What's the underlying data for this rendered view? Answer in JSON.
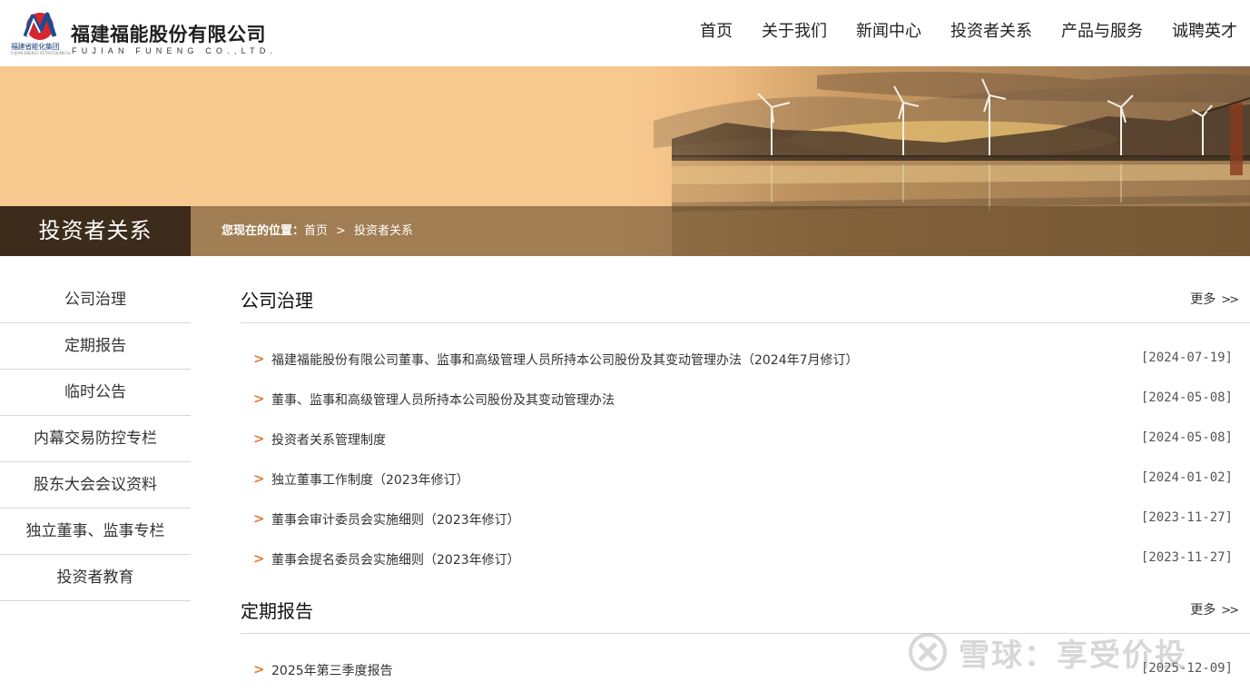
{
  "header": {
    "logo_group_text": "福建省能化集团",
    "logo_group_en": "FUJIAN ENERGY PETROCHEMICAL",
    "company_name_cn": "福建福能股份有限公司",
    "company_name_en": "FUJIAN FUNENG CO.,LTD.",
    "nav": [
      "首页",
      "关于我们",
      "新闻中心",
      "投资者关系",
      "产品与服务",
      "诚聘英才"
    ]
  },
  "banner": {
    "section_label": "投资者关系",
    "breadcrumb_label": "您现在的位置：",
    "breadcrumb": [
      "首页",
      "投资者关系"
    ],
    "breadcrumb_separator": ">"
  },
  "sidebar": {
    "items": [
      "公司治理",
      "定期报告",
      "临时公告",
      "内幕交易防控专栏",
      "股东大会会议资料",
      "独立董事、监事专栏",
      "投资者教育"
    ]
  },
  "sections": [
    {
      "title": "公司治理",
      "more": "更多",
      "items": [
        {
          "title": "福建福能股份有限公司董事、监事和高级管理人员所持本公司股份及其变动管理办法（2024年7月修订）",
          "date": "[2024-07-19]"
        },
        {
          "title": "董事、监事和高级管理人员所持本公司股份及其变动管理办法",
          "date": "[2024-05-08]"
        },
        {
          "title": "投资者关系管理制度",
          "date": "[2024-05-08]"
        },
        {
          "title": "独立董事工作制度（2023年修订）",
          "date": "[2024-01-02]"
        },
        {
          "title": "董事会审计委员会实施细则（2023年修订）",
          "date": "[2023-11-27]"
        },
        {
          "title": "董事会提名委员会实施细则（2023年修订）",
          "date": "[2023-11-27]"
        }
      ]
    },
    {
      "title": "定期报告",
      "more": "更多",
      "items": [
        {
          "title": "2025年第三季度报告",
          "date": "[2025-12-09]"
        }
      ]
    }
  ],
  "watermark": {
    "text": "雪球：享受价投"
  },
  "colors": {
    "accent": "#e07b35",
    "section_label_bg": "#3d2b1c",
    "banner": "#f8c98f"
  }
}
